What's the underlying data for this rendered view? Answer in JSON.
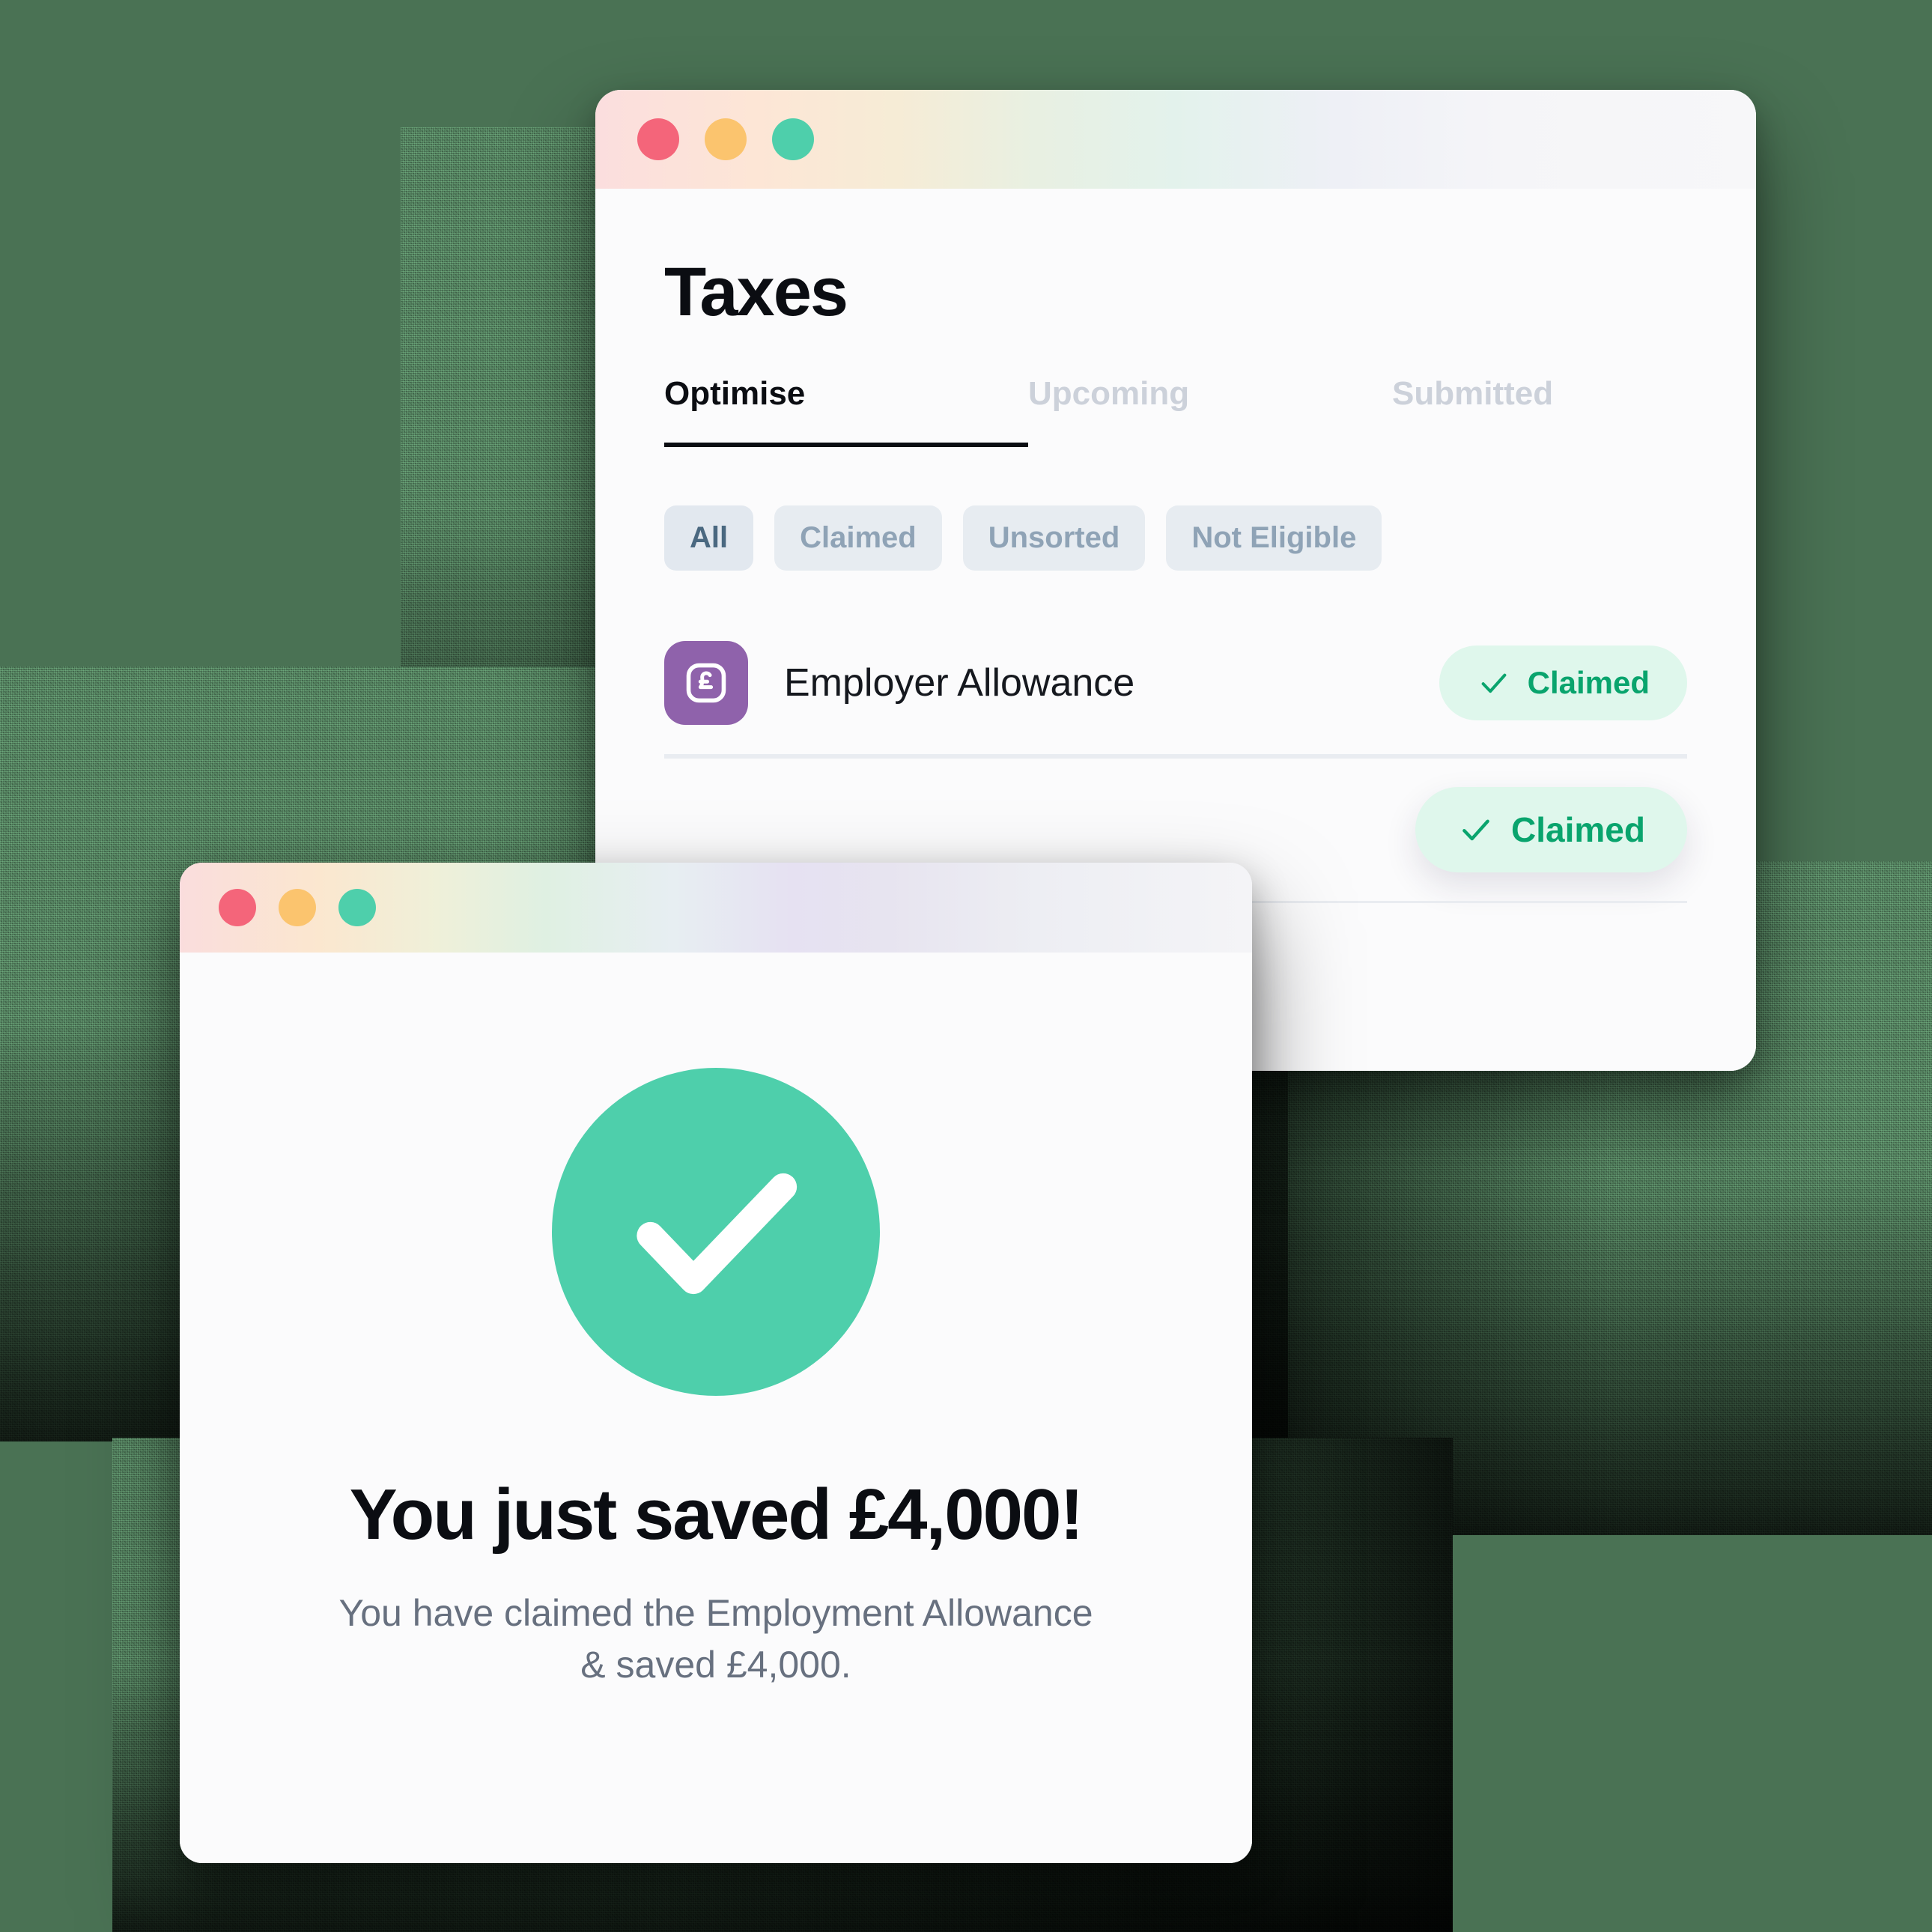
{
  "background": {
    "color": "#4a7254",
    "accent_dark": "#1a1a1a"
  },
  "taxes_window": {
    "name": "Taxes",
    "traffic_lights": [
      {
        "icon": "window-close-dot",
        "color": "#f4657a"
      },
      {
        "icon": "window-minimize-dot",
        "color": "#fbc46e"
      },
      {
        "icon": "window-maximize-dot",
        "color": "#4ecfab"
      }
    ],
    "page_title": "Taxes",
    "tabs": [
      {
        "label": "Optimise",
        "active": true
      },
      {
        "label": "Upcoming",
        "active": false
      },
      {
        "label": "Submitted",
        "active": false
      }
    ],
    "filters": [
      {
        "label": "All",
        "selected": true
      },
      {
        "label": "Claimed",
        "selected": false
      },
      {
        "label": "Unsorted",
        "selected": false
      },
      {
        "label": "Not Eligible",
        "selected": false
      }
    ],
    "rows": [
      {
        "icon": "pound-sterling-icon",
        "icon_color": "#8f62ab",
        "label": "Employer Allowance",
        "status": "Claimed",
        "status_icon": "check-icon",
        "status_color": "#09a46d",
        "status_bg": "#dff7ec"
      },
      {
        "icon": "pound-sterling-icon",
        "icon_color": "#8f62ab",
        "label": "",
        "status": "Claimed",
        "status_icon": "check-icon",
        "status_color": "#09a46d",
        "status_bg": "#dff7ec"
      }
    ]
  },
  "success_window": {
    "traffic_lights": [
      {
        "icon": "window-close-dot",
        "color": "#f4657a"
      },
      {
        "icon": "window-minimize-dot",
        "color": "#fbc46e"
      },
      {
        "icon": "window-maximize-dot",
        "color": "#4ecfab"
      }
    ],
    "check_icon": "check-circle-icon",
    "check_color": "#4ecfab",
    "title": "You just saved £4,000!",
    "subtitle": "You have claimed the Employment Allowance & saved £4,000."
  }
}
